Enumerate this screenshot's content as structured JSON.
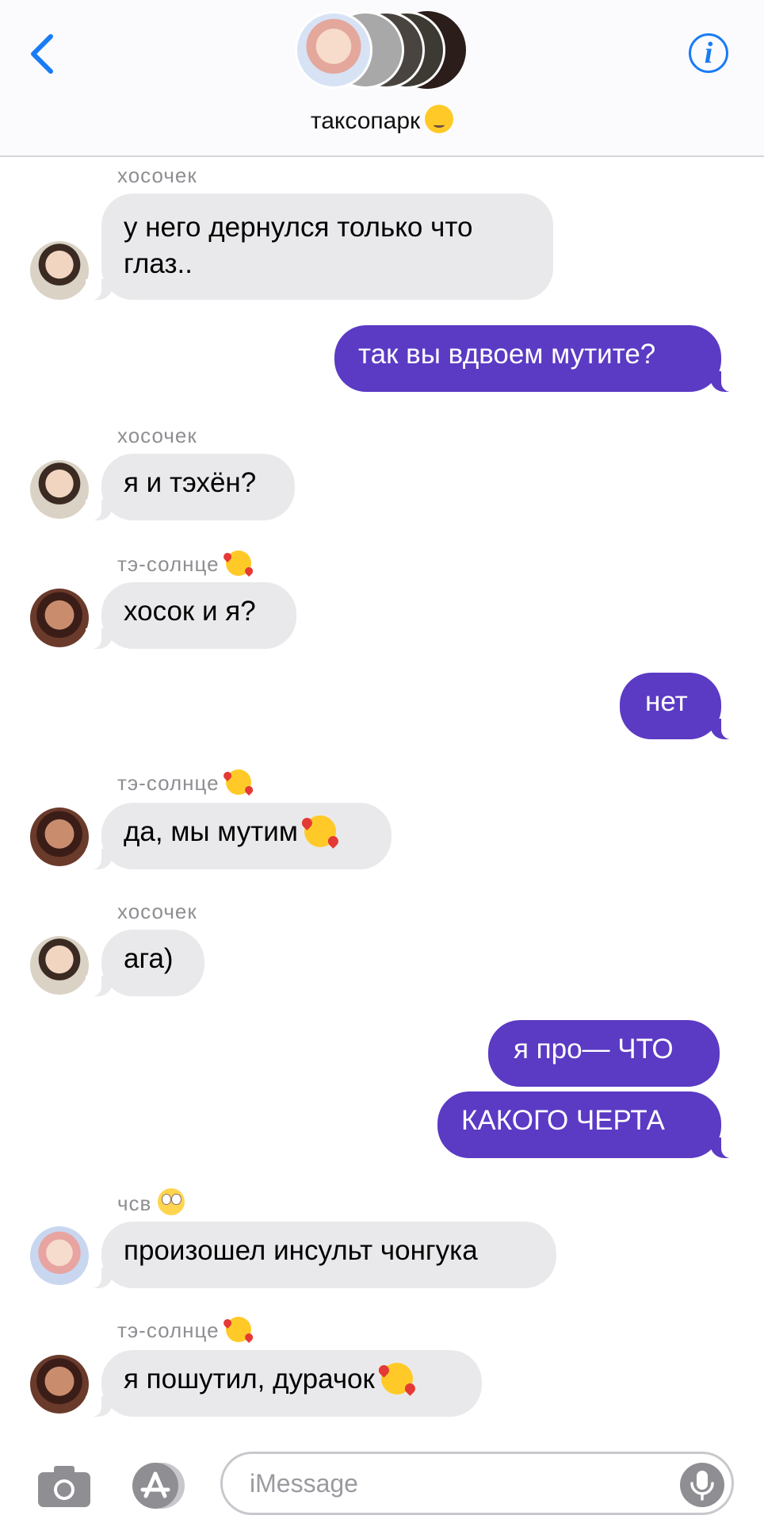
{
  "header": {
    "group_name": "таксопарк",
    "group_emoji": "woozy-face",
    "back_icon": "chevron-left-icon",
    "info_icon": "info-icon",
    "accent_color": "#1a7cf5"
  },
  "colors": {
    "outgoing_bubble": "#5b3ac4",
    "incoming_bubble": "#e9e9eb",
    "sender_name": "#8e8e93"
  },
  "messages": [
    {
      "sender": "хосочек",
      "text": "у него дернулся только что\nглаз.."
    },
    {
      "text": "так вы вдвоем мутите?"
    },
    {
      "sender": "хосочек",
      "text": "я и тэхён?"
    },
    {
      "sender": "тэ-солнце",
      "text": "хосок и я?"
    },
    {
      "text": "нет"
    },
    {
      "sender": "тэ-солнце",
      "text": "да, мы мутим"
    },
    {
      "sender": "хосочек",
      "text": "ага)"
    },
    {
      "text": "я про— ЧТО"
    },
    {
      "text": "КАКОГО ЧЕРТА"
    },
    {
      "sender": "чсв",
      "text": "произошел инсульт чонгука"
    },
    {
      "sender": "тэ-солнце",
      "text": "я пошутил, дурачок"
    }
  ],
  "input": {
    "placeholder": "iMessage",
    "value": ""
  },
  "icons": {
    "camera": "camera-icon",
    "appstore": "app-store-icon",
    "mic": "microphone-icon"
  }
}
